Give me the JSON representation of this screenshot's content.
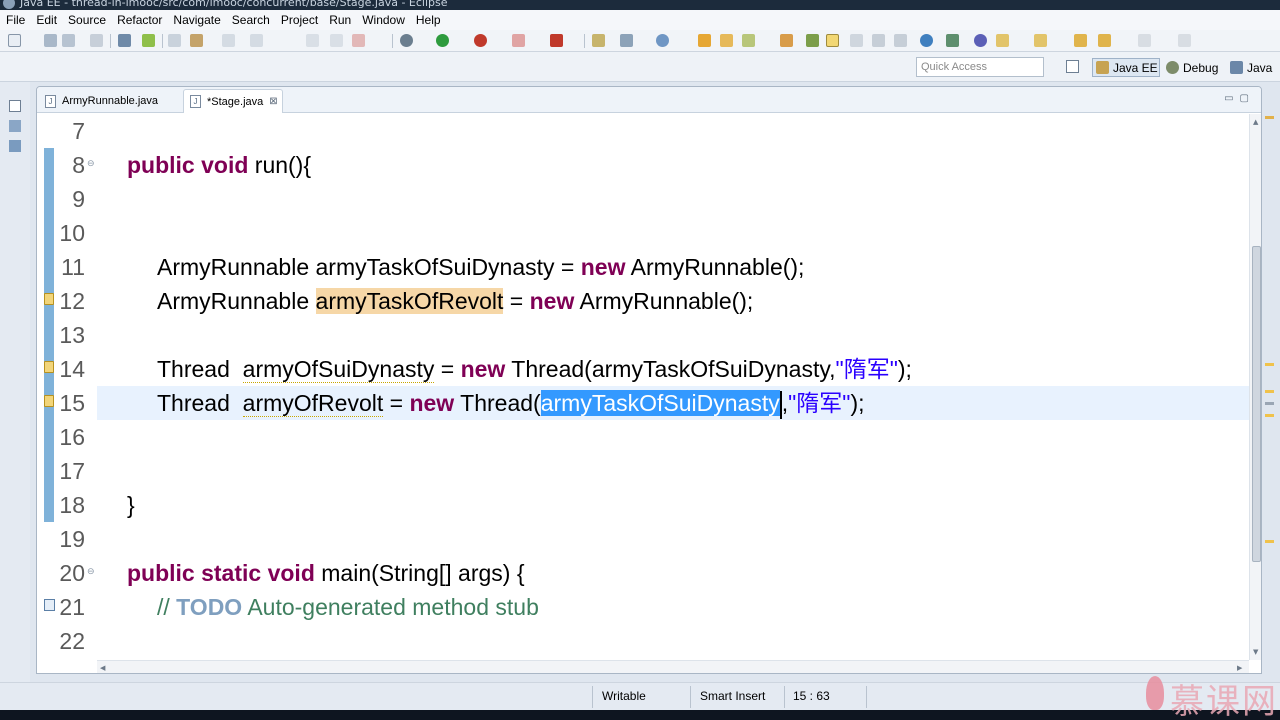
{
  "window": {
    "title": "Java EE - thread-in-imooc/src/com/imooc/concurrent/base/Stage.java - Eclipse"
  },
  "menu": [
    "File",
    "Edit",
    "Source",
    "Refactor",
    "Navigate",
    "Search",
    "Project",
    "Run",
    "Window",
    "Help"
  ],
  "perspective_bar": {
    "quick_access_placeholder": "Quick Access",
    "perspectives": [
      {
        "label": "Java EE",
        "active": true,
        "icon": "java-ee-perspective-icon"
      },
      {
        "label": "Debug",
        "active": false,
        "icon": "debug-perspective-icon"
      },
      {
        "label": "Java",
        "active": false,
        "icon": "java-perspective-icon"
      }
    ]
  },
  "editor": {
    "tabs": [
      {
        "label": "ArmyRunnable.java",
        "active": false
      },
      {
        "label": "*Stage.java",
        "active": true,
        "close": "⊠"
      }
    ],
    "lines": [
      {
        "n": "7"
      },
      {
        "n": "8"
      },
      {
        "n": "9"
      },
      {
        "n": "10"
      },
      {
        "n": "11"
      },
      {
        "n": "12"
      },
      {
        "n": "13"
      },
      {
        "n": "14"
      },
      {
        "n": "15"
      },
      {
        "n": "16"
      },
      {
        "n": "17"
      },
      {
        "n": "18"
      },
      {
        "n": "19"
      },
      {
        "n": "20"
      },
      {
        "n": "21"
      },
      {
        "n": "22"
      }
    ],
    "code": {
      "l8": {
        "kw": "public void",
        "rest": " run(){"
      },
      "l11": {
        "pre": "ArmyRunnable armyTaskOfSuiDynasty = ",
        "kw": "new",
        "post": " ArmyRunnable();"
      },
      "l12": {
        "pre": "ArmyRunnable ",
        "occ": "armyTaskOfRevolt",
        "mid": " = ",
        "kw": "new",
        "post": " ArmyRunnable();"
      },
      "l14": {
        "pre": "Thread  ",
        "var": "armyOfSuiDynasty",
        "mid": " = ",
        "kw": "new",
        "post": " Thread(armyTaskOfSuiDynasty,",
        "str": "\"隋军\"",
        "end": ");"
      },
      "l15": {
        "pre": "Thread  ",
        "var": "armyOfRevolt",
        "mid": " = ",
        "kw": "new",
        "post": " Thread(",
        "sel": "armyTaskOfSuiDynasty",
        "comma": ",",
        "str": "\"隋军\"",
        "end": ");"
      },
      "l18": {
        "text": "}"
      },
      "l20": {
        "kw": "public static void",
        "rest": " main(String[] args) {"
      },
      "l21": {
        "slashes": "// ",
        "todo": "TODO",
        "rest": " Auto-generated method stub"
      }
    }
  },
  "status": {
    "writable": "Writable",
    "insert_mode": "Smart Insert",
    "position": "15 : 63"
  },
  "watermark": {
    "text": "慕课网"
  },
  "colors": {
    "keyword": "#7f0055",
    "string": "#2a00ff",
    "comment": "#3f7f5f",
    "selection": "#3399ff",
    "occurrence": "#f6d7a7",
    "current_line": "#e8f2fe"
  }
}
